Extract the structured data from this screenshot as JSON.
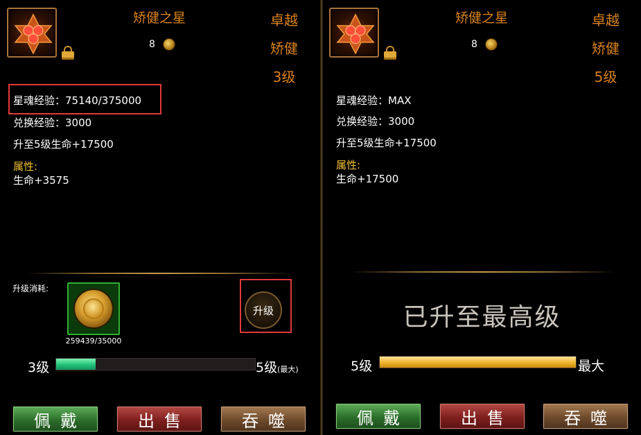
{
  "left": {
    "title": "矫健之星",
    "count": "8",
    "quality": [
      "卓越",
      "矫健",
      "3级"
    ],
    "soul_exp": "星魂经验：75140/375000",
    "exchange_exp": "兑换经验：3000",
    "next_level": "升至5级生命+17500",
    "attr_label": "属性:",
    "attr_value": "生命+3575",
    "cost_label": "升级消耗:",
    "cost_count": "259439/35000",
    "upgrade_button": "升级",
    "level_from": "3级",
    "level_to": "5级",
    "level_to_suffix": "(最大)",
    "progress": 0.2,
    "buttons": [
      "佩戴",
      "出售",
      "吞噬"
    ]
  },
  "right": {
    "title": "矫健之星",
    "count": "8",
    "quality": [
      "卓越",
      "矫健",
      "5级"
    ],
    "soul_exp": "星魂经验：MAX",
    "exchange_exp": "兑换经验：3000",
    "next_level": "升至5级生命+17500",
    "attr_label": "属性:",
    "attr_value": "生命+17500",
    "maxed_text": "已升至最高级",
    "level_from": "5级",
    "level_to": "最大",
    "progress": 1.0,
    "buttons": [
      "佩戴",
      "出售",
      "吞噬"
    ]
  },
  "colors": {
    "title": "#d9821c",
    "attr_label": "#f1c232",
    "highlight": "#e33a3a",
    "progress_green": "#22c37a",
    "progress_gold": "#f0b52c"
  },
  "icons": [
    "hexagram-gem-icon",
    "lock-icon",
    "gold-coin-icon"
  ]
}
